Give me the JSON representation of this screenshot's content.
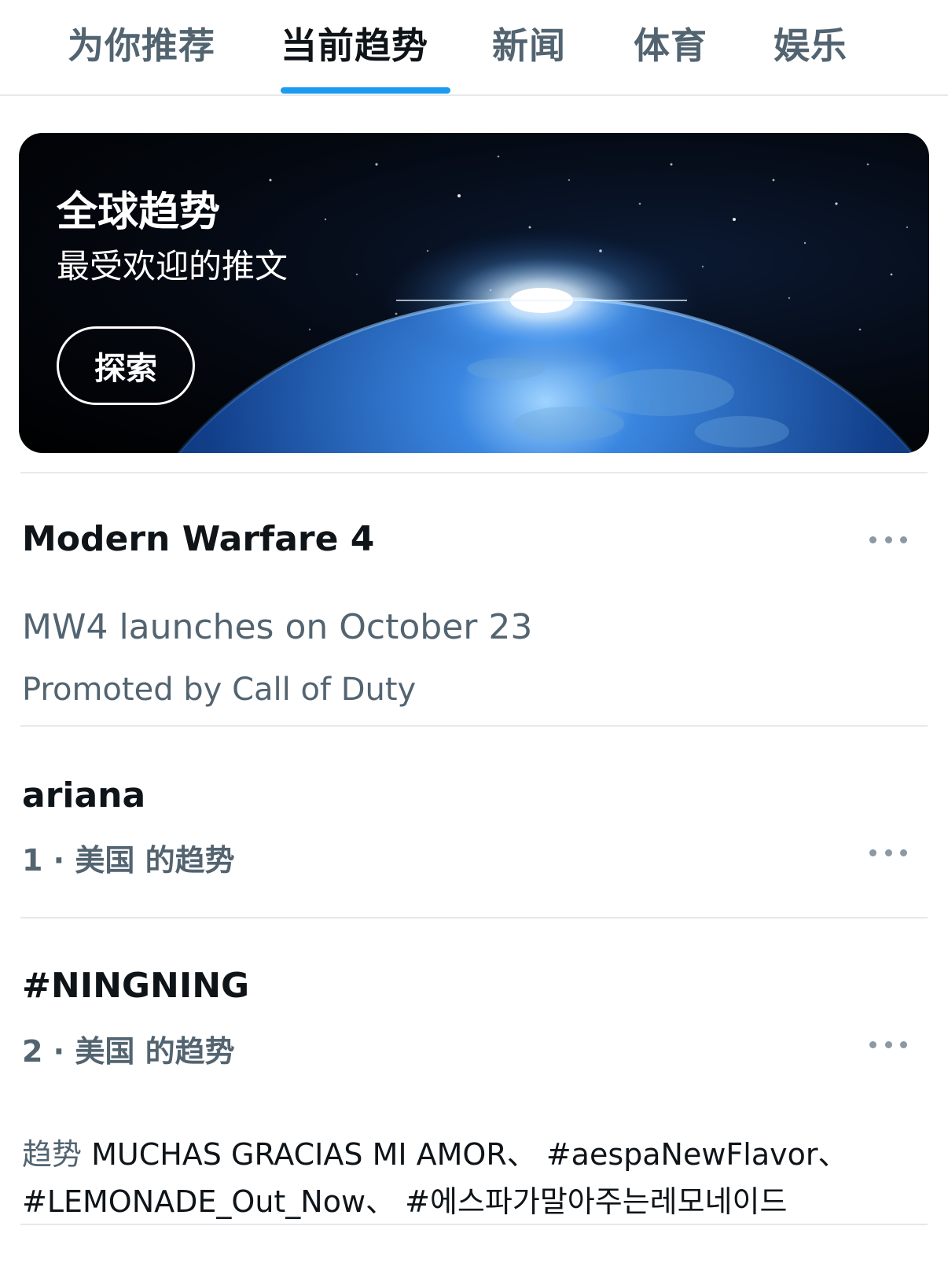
{
  "tabs": [
    {
      "label": "为你推荐",
      "active": false
    },
    {
      "label": "当前趋势",
      "active": true
    },
    {
      "label": "新闻",
      "active": false
    },
    {
      "label": "体育",
      "active": false
    },
    {
      "label": "娱乐",
      "active": false
    }
  ],
  "banner": {
    "title": "全球趋势",
    "subtitle": "最受欢迎的推文",
    "button_label": "探索"
  },
  "trends": {
    "promoted": {
      "title": "Modern Warfare 4",
      "description": "MW4 launches on October 23",
      "promoted_by": "Promoted by Call of Duty",
      "more_icon": "more-horizontal-icon"
    },
    "item1": {
      "title": "ariana",
      "meta": "1 · 美国 的趋势",
      "more_icon": "more-horizontal-icon"
    },
    "item2": {
      "title": "#NINGNING",
      "meta": "2 · 美国 的趋势",
      "related_prefix": "趋势",
      "related_line1": " MUCHAS GRACIAS MI AMOR、 #aespaNewFlavor、",
      "related_line2": "#LEMONADE_Out_Now、 #에스파가말아주는레모네이드",
      "more_icon": "more-horizontal-icon"
    }
  },
  "colors": {
    "accent": "#1d9bf0",
    "text_primary": "#0f1419",
    "text_secondary": "#536471",
    "divider": "#e6e9eb"
  }
}
